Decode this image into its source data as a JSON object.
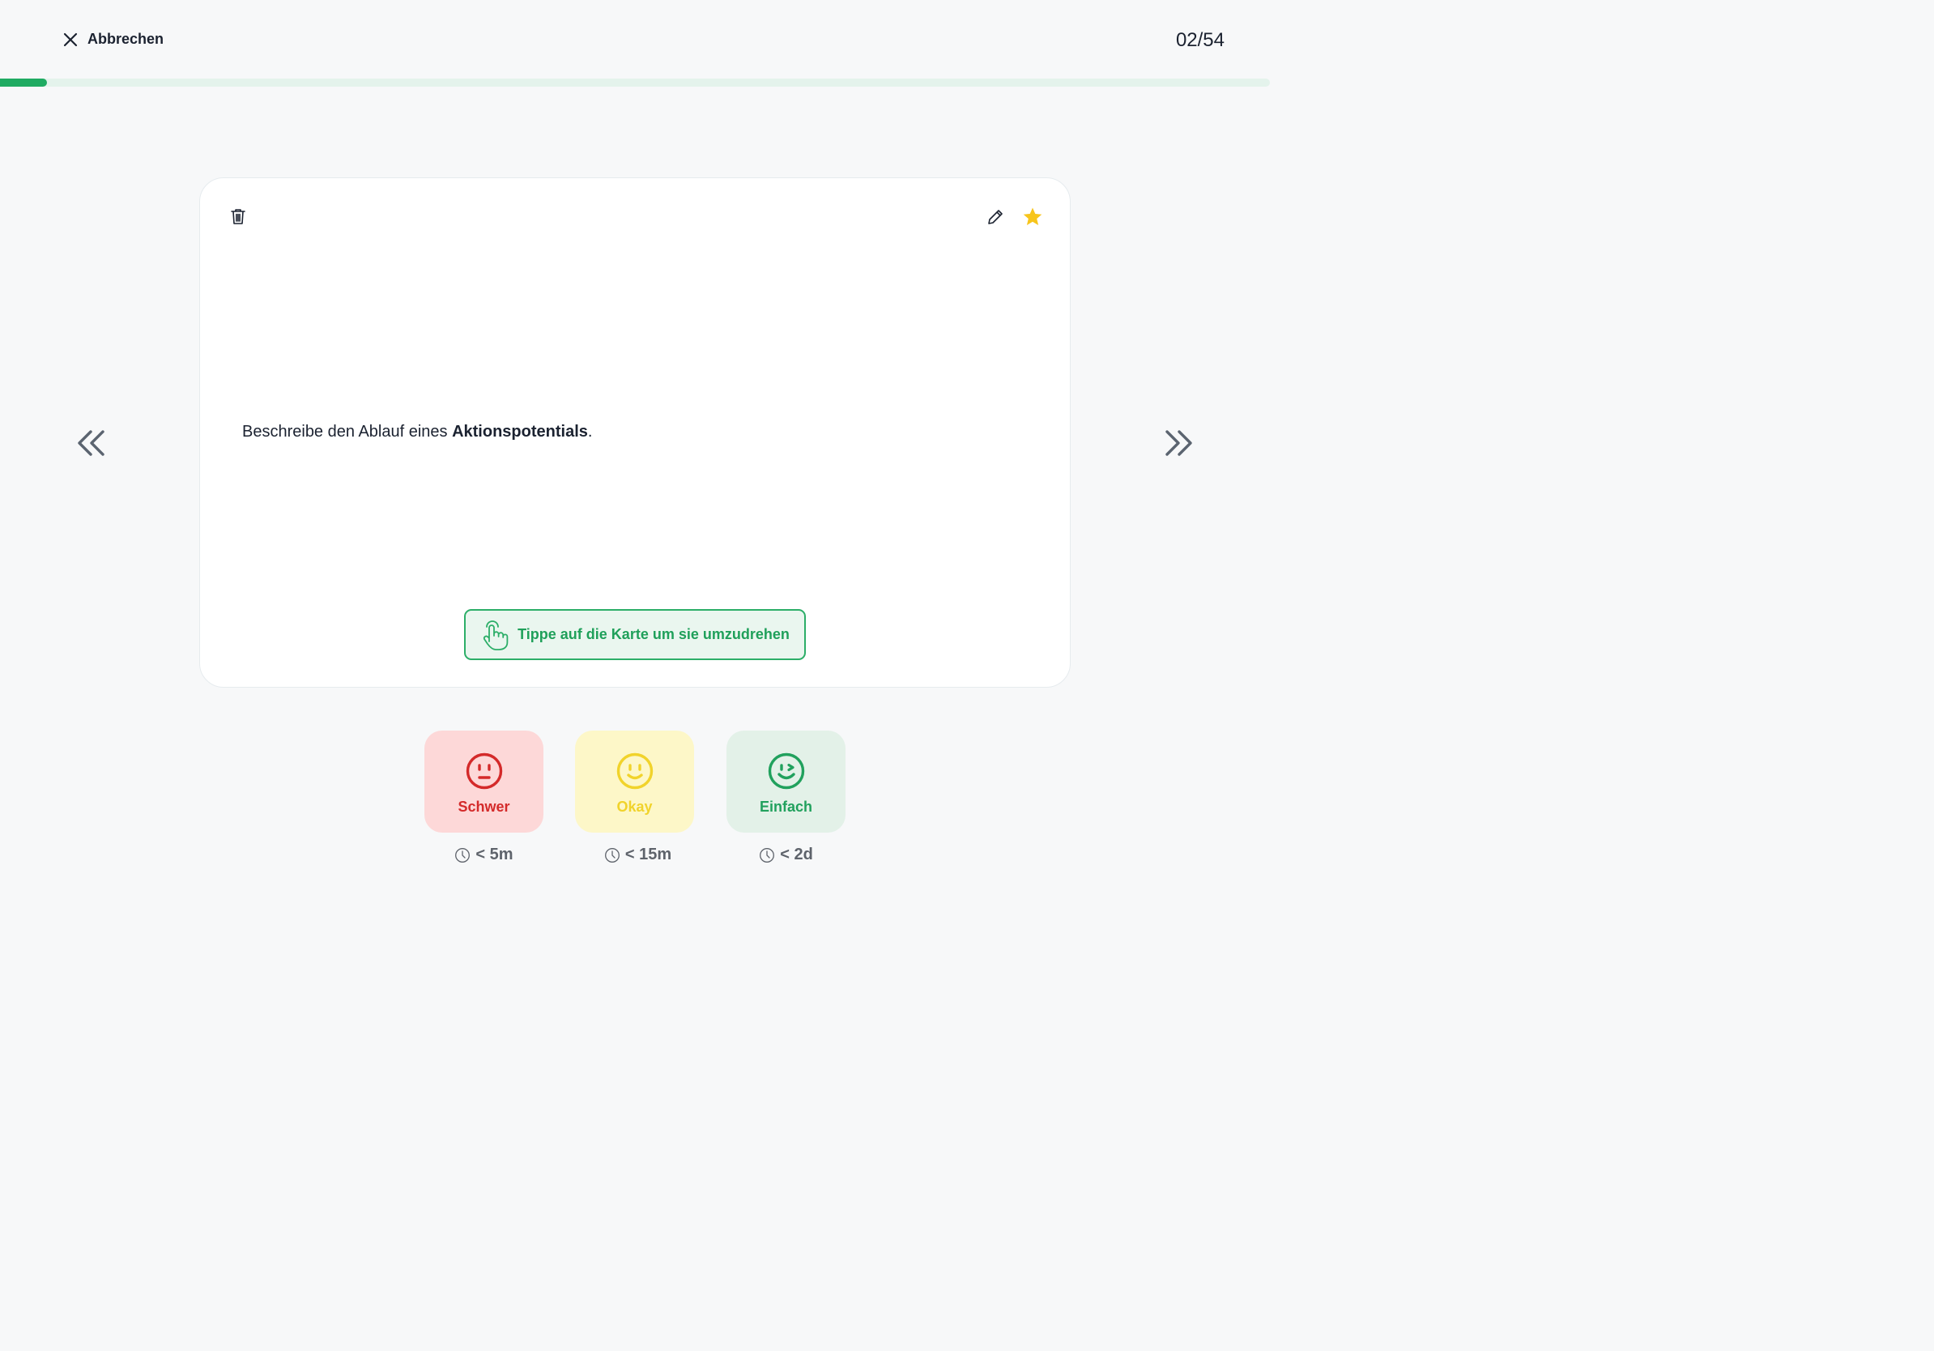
{
  "header": {
    "cancel_label": "Abbrechen",
    "counter": "02/54",
    "progress": {
      "current": 2,
      "total": 54
    }
  },
  "colors": {
    "accent": "#1fab62",
    "hard": "#d42a2a",
    "okay": "#f1d32b",
    "easy": "#21a15d",
    "star": "#f7c51c"
  },
  "card": {
    "question_prefix": "Beschreibe den Ablauf eines ",
    "question_bold": "Aktionspotentials",
    "question_suffix": ".",
    "flip_hint": "Tippe auf die Karte um sie umzudrehen",
    "icons": [
      "trash-icon",
      "pencil-icon",
      "star-icon"
    ],
    "favorite": true
  },
  "ratings": [
    {
      "label": "Schwer",
      "interval": "< 5m",
      "icon": "neutral-face-icon"
    },
    {
      "label": "Okay",
      "interval": "< 15m",
      "icon": "smile-face-icon"
    },
    {
      "label": "Einfach",
      "interval": "< 2d",
      "icon": "wink-face-icon"
    }
  ]
}
